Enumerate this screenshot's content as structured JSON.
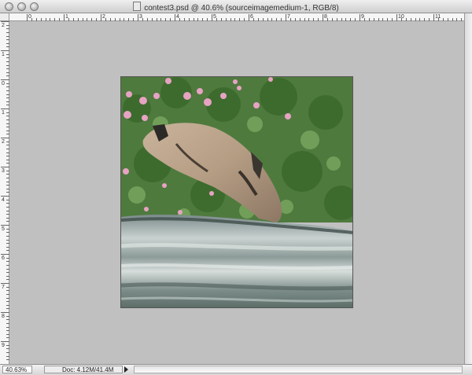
{
  "window": {
    "title": "contest3.psd @ 40.6% (sourceimagemedium-1, RGB/8)"
  },
  "rulers": {
    "top_labels": [
      "0",
      "1",
      "2",
      "3",
      "4",
      "5",
      "6",
      "7",
      "8",
      "9",
      "10",
      "11"
    ],
    "left_labels": [
      "2",
      "1",
      "0",
      "1",
      "2",
      "3",
      "4",
      "5",
      "6",
      "7",
      "8",
      "9"
    ]
  },
  "status": {
    "zoom": "40.63%",
    "doc_info": "Doc: 4.12M/41.4M"
  },
  "colors": {
    "pasteboard": "#c0c0c0",
    "ruler_bg": "#f6f6f6"
  }
}
